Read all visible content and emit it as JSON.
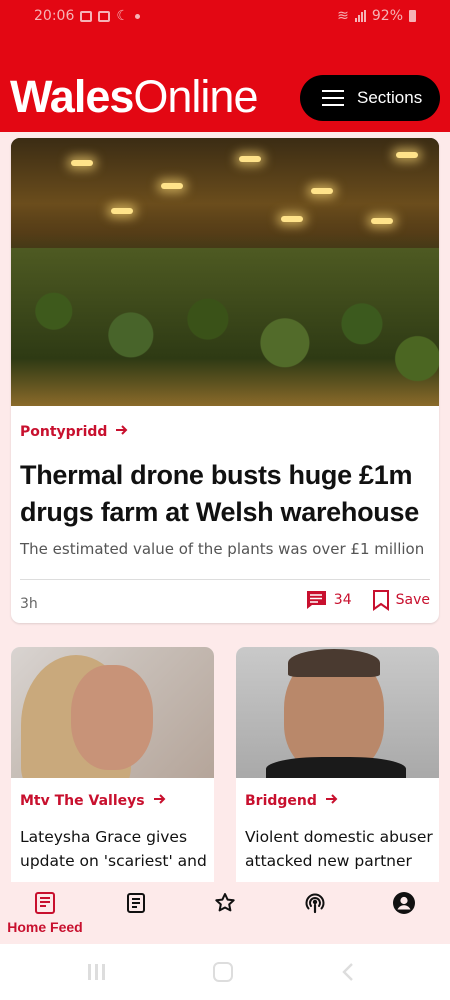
{
  "status_bar": {
    "time": "20:06",
    "battery": "92%"
  },
  "header": {
    "logo_bold": "Wales",
    "logo_thin": "Online",
    "sections_label": "Sections"
  },
  "main_article": {
    "tag": "Pontypridd",
    "headline": "Thermal drone busts huge £1m drugs farm at Welsh warehouse",
    "standfirst": "The estimated value of the plants was over £1 million",
    "time": "3h",
    "comment_count": "34",
    "save_label": "Save"
  },
  "articles": [
    {
      "tag": "Mtv The Valleys",
      "headline": "Lateysha Grace gives update on 'scariest' and"
    },
    {
      "tag": "Bridgend",
      "headline": "Violent domestic abuser attacked new partner"
    }
  ],
  "bottom_nav": {
    "home_feed_label": "Home Feed"
  },
  "colors": {
    "brand_red": "#e30713",
    "accent_red": "#c8102e",
    "feed_background": "#fdeaea"
  }
}
